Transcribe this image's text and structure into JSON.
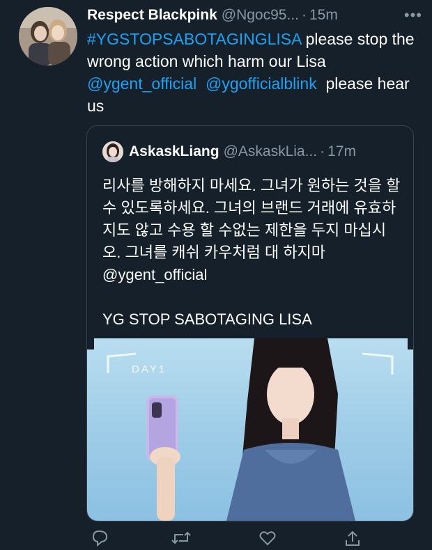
{
  "tweet": {
    "display_name": "Respect Blackpink",
    "handle": "@Ngoc95...",
    "separator": "·",
    "time": "15m",
    "more_label": "•••",
    "hashtag": "#YGSTOPSABOTAGINGLISA",
    "text_after_hashtag": " please stop the wrong action which harm our Lisa",
    "mention_1": "@ygent_official",
    "mention_2": "@ygofficialblink",
    "text_end": "please hear us"
  },
  "quoted_tweet": {
    "display_name": "AskaskLiang",
    "handle": "@AskaskLia...",
    "separator": "·",
    "time": "17m",
    "text_korean": "리사를 방해하지 마세요. 그녀가 원하는 것을 할 수 있도록하세요. 그녀의 브랜드 거래에 유효하지도 않고 수용 할 수없는 제한을 두지 마십시오. 그녀를 캐쉬 카우처럼 대 하지마 @ygent_official",
    "text_english": "YG STOP SABOTAGING LISA",
    "image": {
      "overlay_text": "DAY1"
    }
  },
  "actions": {
    "icons": [
      "reply-icon",
      "retweet-icon",
      "like-icon",
      "share-icon"
    ]
  },
  "colors": {
    "background": "#15202b",
    "link": "#1da1f2",
    "secondary_text": "#8899a6",
    "border": "#38444d"
  }
}
